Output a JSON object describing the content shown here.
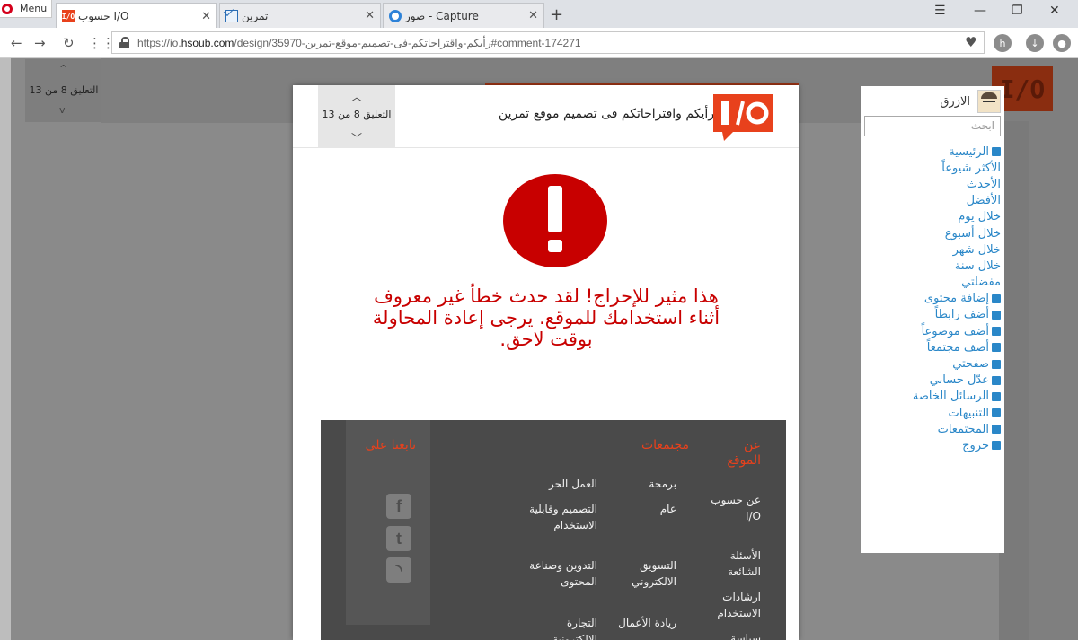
{
  "browser": {
    "menu_label": "Menu",
    "tabs": [
      {
        "title": "حسوب I/O",
        "icon": "io-logo-icon",
        "active": true
      },
      {
        "title": "تمرين",
        "icon": "mail-icon",
        "active": false
      },
      {
        "title": "صور - Capture",
        "icon": "capture-icon",
        "active": false
      }
    ],
    "url_prefix": "https://io.",
    "url_domain": "hsoub.com",
    "url_path": "/design/35970-رأيكم-واقتراحاتكم-فى-تصميم-موقع-تمرين#comment-174271"
  },
  "background_nav": {
    "counter": "التعليق 8 من 13"
  },
  "sidebar": {
    "username": "الازرق",
    "search_placeholder": "ابحث",
    "links": [
      {
        "label": "الرئيسية",
        "icon": "home-icon"
      },
      {
        "label": "الأكثر شيوعاً",
        "icon": ""
      },
      {
        "label": "الأحدث",
        "icon": ""
      },
      {
        "label": "الأفضل",
        "icon": ""
      },
      {
        "label": "خلال يوم",
        "icon": ""
      },
      {
        "label": "خلال أسبوع",
        "icon": ""
      },
      {
        "label": "خلال شهر",
        "icon": ""
      },
      {
        "label": "خلال سنة",
        "icon": ""
      },
      {
        "label": "مفضلتي",
        "icon": ""
      },
      {
        "label": "إضافة محتوى",
        "icon": "pencil-icon"
      },
      {
        "label": "أضف رابطاً",
        "icon": "link-icon"
      },
      {
        "label": "أضف موضوعاً",
        "icon": "list-icon"
      },
      {
        "label": "أضف مجتمعاً",
        "icon": "grid-icon"
      },
      {
        "label": "صفحتي",
        "icon": "user-icon"
      },
      {
        "label": "عدّل حسابي",
        "icon": "gear-icon"
      },
      {
        "label": "الرسائل الخاصة",
        "icon": "envelope-icon"
      },
      {
        "label": "التنبيهات",
        "icon": "bell-icon"
      },
      {
        "label": "المجتمعات",
        "icon": "grid-icon"
      },
      {
        "label": "خروج",
        "icon": "signout-icon"
      }
    ]
  },
  "modal": {
    "title": "رأيكم واقتراحاتكم فى تصميم موقع تمرين",
    "counter": "التعليق 8 من 13",
    "error_message": "هذا مثير للإحراج! لقد حدث خطأ غير معروف أثناء استخدامك للموقع. يرجى إعادة المحاولة بوقت لاحق.",
    "footer": {
      "about_heading": "عن الموقع",
      "about_items": [
        "عن حسوب I/O",
        "الأسئلة الشائعة",
        "ارشادات الاستخدام",
        "سياسة"
      ],
      "communities_heading": "مجتمعات",
      "communities_col1": [
        "برمجة",
        "عام",
        "التسويق الالكتروني",
        "ريادة الأعمال"
      ],
      "communities_col2": [
        "العمل الحر",
        "التصميم وقابلية الاستخدام",
        "التدوين وصناعة المحتوى",
        "التجارة الالكترونية"
      ],
      "follow_heading": "تابعنا على",
      "social": [
        "facebook-icon",
        "twitter-icon",
        "rss-icon"
      ]
    }
  },
  "colors": {
    "brand_orange": "#e8411c",
    "error_red": "#c80000",
    "link_blue": "#2a87c8",
    "footer_bg": "#4a4a4a"
  }
}
